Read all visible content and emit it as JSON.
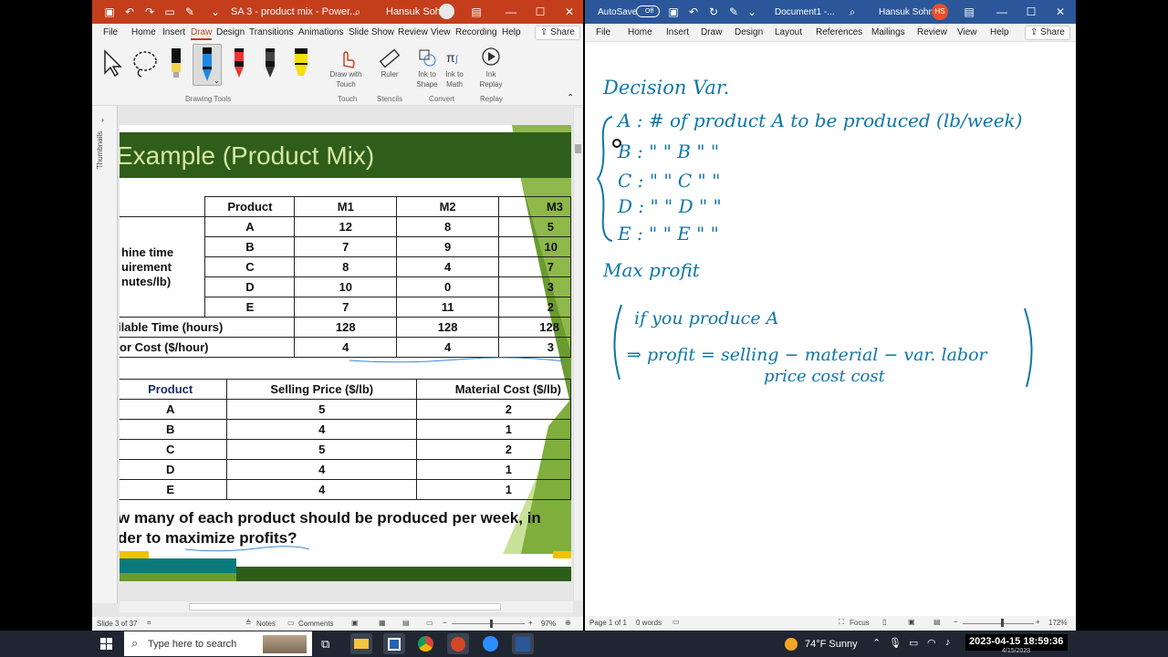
{
  "ppt": {
    "title": "SA 3 - product mix  -  Power...",
    "user": "Hansuk Sohn",
    "menu": [
      "File",
      "Home",
      "Insert",
      "Draw",
      "Design",
      "Transitions",
      "Animations",
      "Slide Show",
      "Review",
      "View",
      "Recording",
      "Help"
    ],
    "active_menu": "Draw",
    "share": "Share",
    "ribbon": {
      "draw_with_touch": "Draw with Touch",
      "ruler": "Ruler",
      "ink_to_shape": "Ink to Shape",
      "ink_to_math": "Ink to Math",
      "ink_replay": "Ink Replay",
      "groups": [
        "Drawing Tools",
        "Touch",
        "Stencils",
        "Convert",
        "Replay"
      ]
    },
    "thumbnails_label": "Thumbnails",
    "slide": {
      "title": "Example (Product Mix)",
      "table1": {
        "headers": [
          "Product",
          "M1",
          "M2",
          "M3"
        ],
        "row_label": [
          "hine time",
          "uirement",
          "nutes/lb)"
        ],
        "rows": [
          [
            "A",
            "12",
            "8",
            "5"
          ],
          [
            "B",
            "7",
            "9",
            "10"
          ],
          [
            "C",
            "8",
            "4",
            "7"
          ],
          [
            "D",
            "10",
            "0",
            "3"
          ],
          [
            "E",
            "7",
            "11",
            "2"
          ]
        ],
        "avail_label": "ilable Time (hours)",
        "avail": [
          "128",
          "128",
          "128"
        ],
        "labor_label": "or Cost ($/hour)",
        "labor": [
          "4",
          "4",
          "3"
        ]
      },
      "table2": {
        "headers": [
          "Product",
          "Selling Price ($/lb)",
          "Material Cost ($/lb)"
        ],
        "rows": [
          [
            "A",
            "5",
            "2"
          ],
          [
            "B",
            "4",
            "1"
          ],
          [
            "C",
            "5",
            "2"
          ],
          [
            "D",
            "4",
            "1"
          ],
          [
            "E",
            "4",
            "1"
          ]
        ]
      },
      "question_line1": "w many of each product should be produced per week, in",
      "question_line2": "der to maximize profits?"
    },
    "status": {
      "slide_of": "Slide 3 of 37",
      "notes": "Notes",
      "comments": "Comments",
      "zoom": "97%"
    }
  },
  "word": {
    "autosave": "AutoSave",
    "autosave_state": "Off",
    "title": "Document1 -...",
    "user": "Hansuk Sohn",
    "initials": "HS",
    "menu": [
      "File",
      "Home",
      "Insert",
      "Draw",
      "Design",
      "Layout",
      "References",
      "Mailings",
      "Review",
      "View",
      "Help"
    ],
    "share": "Share",
    "ink": {
      "l1": "Decision Var.",
      "l2": "A : # of product A to be produced (lb/week)",
      "l3": "B :      \"        \"    B        \"        \"",
      "l4": "C :      \"        \"    C        \"        \"",
      "l5": "D :      \"        \"    D        \"        \"",
      "l6": "E :      \"        \"    E        \"        \"",
      "l7": "Max profit",
      "l8": "if you produce A",
      "l9": "⇒ profit = selling − material − var. labor",
      "l10": "price        cost           cost"
    },
    "status": {
      "page": "Page 1 of 1",
      "words": "0 words",
      "focus": "Focus",
      "zoom": "172%"
    }
  },
  "taskbar": {
    "search_placeholder": "Type here to search",
    "weather": "74°F  Sunny",
    "datetime": "2023-04-15  18:59:36",
    "date_small": "4/15/2023"
  }
}
